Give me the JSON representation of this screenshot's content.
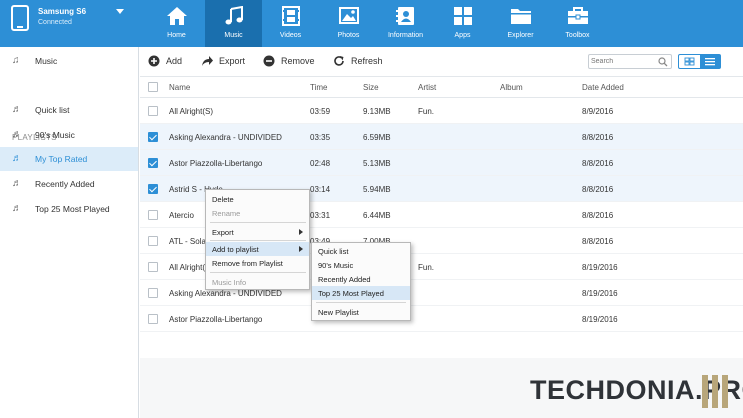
{
  "device": {
    "name": "Samsung S6",
    "status": "Connected"
  },
  "nav": [
    {
      "label": "Home",
      "icon": "home-icon"
    },
    {
      "label": "Music",
      "icon": "music-icon"
    },
    {
      "label": "Videos",
      "icon": "film-icon"
    },
    {
      "label": "Photos",
      "icon": "photo-icon"
    },
    {
      "label": "Information",
      "icon": "contact-card-icon"
    },
    {
      "label": "Apps",
      "icon": "apps-icon"
    },
    {
      "label": "Explorer",
      "icon": "folder-icon"
    },
    {
      "label": "Toolbox",
      "icon": "toolbox-icon"
    }
  ],
  "sidebar": {
    "music_label": "Music",
    "playlists_header": "PLAYLISTS",
    "playlists": [
      "Quick list",
      "90's Music",
      "My Top Rated",
      "Recently Added",
      "Top 25 Most Played"
    ]
  },
  "toolbar": {
    "add": "Add",
    "export": "Export",
    "remove": "Remove",
    "refresh": "Refresh",
    "search_placeholder": "Search"
  },
  "table": {
    "headers": {
      "name": "Name",
      "time": "Time",
      "size": "Size",
      "artist": "Artist",
      "album": "Album",
      "date": "Date Added"
    },
    "rows": [
      {
        "name": "All Alright(S)",
        "time": "03:59",
        "size": "9.13MB",
        "artist": "Fun.",
        "album": "",
        "date": "8/9/2016",
        "checked": false
      },
      {
        "name": "Asking Alexandra - UNDIVIDED",
        "time": "03:35",
        "size": "6.59MB",
        "artist": "",
        "album": "",
        "date": "8/8/2016",
        "checked": true
      },
      {
        "name": "Astor Piazzolla-Libertango",
        "time": "02:48",
        "size": "5.13MB",
        "artist": "",
        "album": "",
        "date": "8/8/2016",
        "checked": true
      },
      {
        "name": "Astrid S - Hyde",
        "time": "03:14",
        "size": "5.94MB",
        "artist": "",
        "album": "",
        "date": "8/8/2016",
        "checked": true
      },
      {
        "name": "Atercio",
        "time": "03:31",
        "size": "6.44MB",
        "artist": "",
        "album": "",
        "date": "8/8/2016",
        "checked": false
      },
      {
        "name": "ATL - Sola",
        "time": "03:49",
        "size": "7.00MB",
        "artist": "",
        "album": "",
        "date": "8/8/2016",
        "checked": false
      },
      {
        "name": "All Alright(S)",
        "time": "",
        "size": "",
        "artist": "Fun.",
        "album": "",
        "date": "8/19/2016",
        "checked": false
      },
      {
        "name": "Asking Alexandra - UNDIVIDED",
        "time": "",
        "size": "",
        "artist": "",
        "album": "",
        "date": "8/19/2016",
        "checked": false
      },
      {
        "name": "Astor Piazzolla-Libertango",
        "time": "",
        "size": "",
        "artist": "",
        "album": "",
        "date": "8/19/2016",
        "checked": false
      }
    ]
  },
  "context_menu": {
    "items": [
      "Delete",
      "Rename",
      "Export",
      "Add to playlist",
      "Remove from Playlist",
      "Music Info"
    ]
  },
  "submenu": {
    "items": [
      "Quick list",
      "90's Music",
      "Recently Added",
      "Top 25 Most Played",
      "New Playlist"
    ]
  },
  "watermark": "TECHDONIA.PRO",
  "colors": {
    "accent": "#2d8fd6",
    "nav_active": "#1a6fae",
    "selected_row": "#eef5fc",
    "sidebar_active": "#dcecf9"
  }
}
